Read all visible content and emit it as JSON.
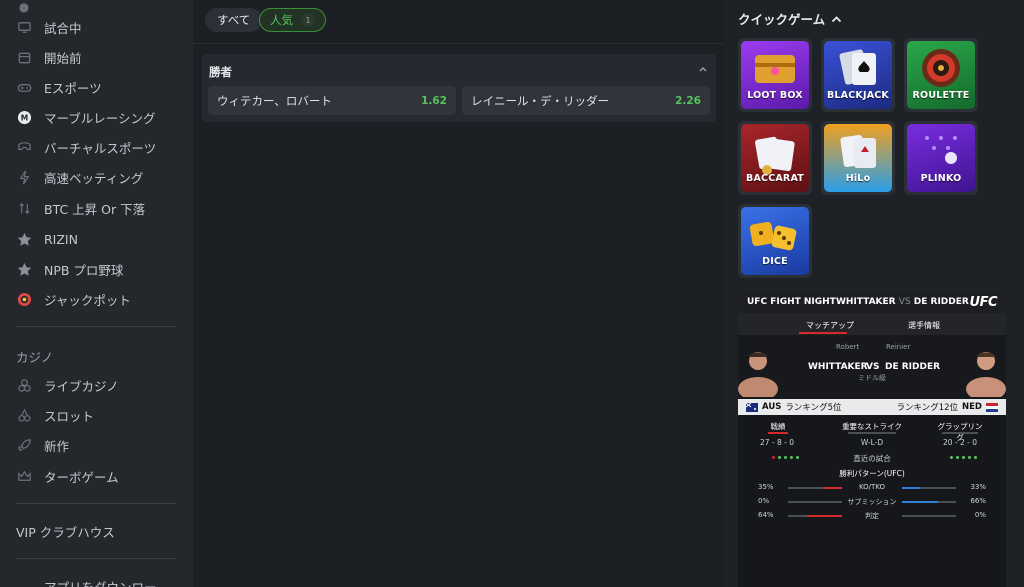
{
  "sidebar": {
    "items": [
      {
        "label": "試合中",
        "icon": "monitor-icon"
      },
      {
        "label": "開始前",
        "icon": "calendar-icon"
      },
      {
        "label": "Eスポーツ",
        "icon": "gamepad-icon"
      },
      {
        "label": "マーブルレーシング",
        "icon": "marble-icon"
      },
      {
        "label": "バーチャルスポーツ",
        "icon": "vr-headset-icon"
      },
      {
        "label": "高速ベッティング",
        "icon": "lightning-icon"
      },
      {
        "label": "BTC 上昇 Or 下落",
        "icon": "up-down-arrows-icon"
      },
      {
        "label": "RIZIN",
        "icon": "star-icon"
      },
      {
        "label": "NPB プロ野球",
        "icon": "star-icon"
      },
      {
        "label": "ジャックポット",
        "icon": "jackpot-icon"
      }
    ],
    "casino_header": "カジノ",
    "casino_items": [
      {
        "label": "ライブカジノ",
        "icon": "chips-icon"
      },
      {
        "label": "スロット",
        "icon": "cherries-icon"
      },
      {
        "label": "新作",
        "icon": "rocket-icon"
      },
      {
        "label": "ターボゲーム",
        "icon": "crown-icon"
      }
    ],
    "vip_label": "VIP クラブハウス",
    "app_label": "アプリをダウンロー"
  },
  "filters": {
    "all_label": "すべて",
    "popular_label": "人気",
    "popular_count": "1"
  },
  "market": {
    "title": "勝者",
    "options": [
      {
        "name": "ウィテカー、ロバート",
        "price": "1.62"
      },
      {
        "name": "レイニール・デ・リッダー",
        "price": "2.26"
      }
    ]
  },
  "quick_games": {
    "title": "クイックゲーム",
    "games": [
      {
        "label": "LOOT BOX",
        "color": "#7a2fd1"
      },
      {
        "label": "BLACKJACK",
        "color": "#2a3fb0"
      },
      {
        "label": "ROULETTE",
        "color": "#1f8c3a"
      },
      {
        "label": "BACCARAT",
        "color": "#8f1d1d"
      },
      {
        "label": "HiLo",
        "color": "#1d8fd8"
      },
      {
        "label": "PLINKO",
        "color": "#6a22c8"
      },
      {
        "label": "DICE",
        "color": "#2f5fd6"
      }
    ]
  },
  "ufc": {
    "event": "UFC FIGHT NIGHT",
    "matchup_left": "WHITTAKER",
    "matchup_vs": "VS",
    "matchup_right": "DE RIDDER",
    "logo": "UFC",
    "tab_matchup": "マッチアップ",
    "tab_fighter_info": "選手情報",
    "fighter1_first": "Robert",
    "fighter1_last": "WHITTAKER",
    "vs": "VS",
    "fighter2_first": "Reinier",
    "fighter2_last": "DE RIDDER",
    "weight_class": "ミドル級",
    "left_country": "AUS",
    "left_rank": "ランキング5位",
    "right_rank": "ランキング12位",
    "right_country": "NED",
    "stats": {
      "record_label": "戦績",
      "record_left": "27 - 8 - 0",
      "strike_label": "重要なストライク",
      "strike_value": "W-L-D",
      "grappling_label": "グラップリング",
      "grappling_right": "20 - 2 - 0",
      "recent_label": "直近の試合"
    },
    "win_patterns_title": "勝利パターン(UFC)",
    "win_patterns": [
      {
        "label": "KO/TKO",
        "left": "35%",
        "right": "33%",
        "left_frac": 0.35,
        "right_frac": 0.33
      },
      {
        "label": "サブミッション",
        "left": "0%",
        "right": "66%",
        "left_frac": 0.0,
        "right_frac": 0.66
      },
      {
        "label": "判定",
        "left": "64%",
        "right": "0%",
        "left_frac": 0.64,
        "right_frac": 0.0
      }
    ]
  }
}
